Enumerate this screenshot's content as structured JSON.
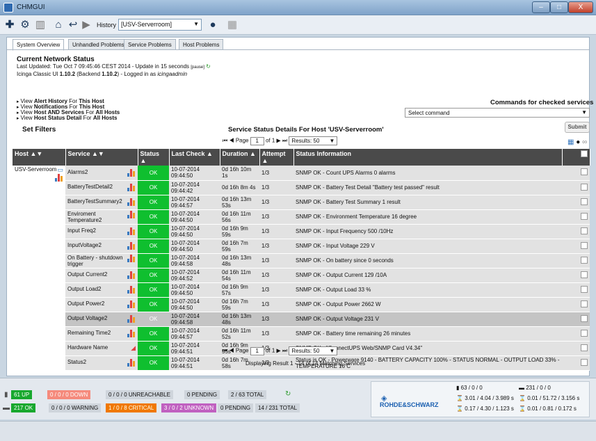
{
  "window": {
    "title": "CHMGUI",
    "min": "–",
    "max": "□",
    "close": "X"
  },
  "toolbar": {
    "history_label": "History",
    "history_value": "[USV-Serverroom]"
  },
  "tabs": [
    "System Overview",
    "Unhandled Problems",
    "Service Problems",
    "Host Problems"
  ],
  "status_info": {
    "heading": "Current Network Status",
    "line1_a": "Last Updated: Tue Oct 7 09:45:46 CEST 2014 - Update in 15 seconds ",
    "line1_pause": "[pause]",
    "line2_a": "Icinga Classic UI ",
    "line2_ver": "1.10.2",
    "line2_b": " (Backend ",
    "line2_be": "1.10.2",
    "line2_c": ") - Logged in as ",
    "line2_user": "icingaadmin"
  },
  "links": [
    [
      "View ",
      "Alert History",
      " For ",
      "This Host"
    ],
    [
      "View ",
      "Notifications",
      " For ",
      "This Host"
    ],
    [
      "View ",
      "Host AND Services",
      " For ",
      "All Hosts"
    ],
    [
      "View ",
      "Host Status Detail",
      " For ",
      "All Hosts"
    ]
  ],
  "set_filters": "Set Filters",
  "commands": {
    "heading": "Commands for checked services",
    "select": "Select command",
    "submit": "Submit"
  },
  "table_title": "Service Status Details For Host 'USV-Serverroom'",
  "pager": {
    "page_label": "Page",
    "page": "1",
    "of": "of 1",
    "results": "Results: 50"
  },
  "columns": [
    "Host ▲▼",
    "Service ▲▼",
    "Status ▲",
    "Last Check ▲",
    "Duration ▲",
    "Attempt ▲",
    "Status Information"
  ],
  "host": "USV-Serverroom",
  "rows": [
    {
      "service": "Alarms2",
      "status": "OK",
      "last": "10-07-2014 09:44:50",
      "dur": "0d 16h 10m 1s",
      "att": "1/3",
      "info": "SNMP OK - Count UPS Alarms 0 alarms",
      "hl": false
    },
    {
      "service": "BatteryTestDetail2",
      "status": "OK",
      "last": "10-07-2014 09:44:42",
      "dur": "0d 16h 8m 4s",
      "att": "1/3",
      "info": "SNMP OK - Battery Test Detail \"Battery test passed\" result",
      "hl": false
    },
    {
      "service": "BatteryTestSummary2",
      "status": "OK",
      "last": "10-07-2014 09:44:57",
      "dur": "0d 16h 13m 53s",
      "att": "1/3",
      "info": "SNMP OK - Battery Test Summary 1 result",
      "hl": false
    },
    {
      "service": "Enviroment Temperature2",
      "status": "OK",
      "last": "10-07-2014 09:44:50",
      "dur": "0d 16h 11m 56s",
      "att": "1/3",
      "info": "SNMP OK - Environment Temperature 16 degree",
      "hl": false
    },
    {
      "service": "Input Freq2",
      "status": "OK",
      "last": "10-07-2014 09:44:50",
      "dur": "0d 16h 9m 59s",
      "att": "1/3",
      "info": "SNMP OK - Input Frequency 500 /10Hz",
      "hl": false
    },
    {
      "service": "InputVoltage2",
      "status": "OK",
      "last": "10-07-2014 09:44:50",
      "dur": "0d 16h 7m 59s",
      "att": "1/3",
      "info": "SNMP OK - Input Voltage 229 V",
      "hl": false
    },
    {
      "service": "On Battery - shutdown trigger",
      "status": "OK",
      "last": "10-07-2014 09:44:58",
      "dur": "0d 16h 13m 48s",
      "att": "1/3",
      "info": "SNMP OK - On battery since 0 seconds",
      "hl": false
    },
    {
      "service": "Output Current2",
      "status": "OK",
      "last": "10-07-2014 09:44:52",
      "dur": "0d 16h 11m 54s",
      "att": "1/3",
      "info": "SNMP OK - Output Current 129 /10A",
      "hl": false
    },
    {
      "service": "Output Load2",
      "status": "OK",
      "last": "10-07-2014 09:44:50",
      "dur": "0d 16h 9m 57s",
      "att": "1/3",
      "info": "SNMP OK - Output Load 33 %",
      "hl": false
    },
    {
      "service": "Output Power2",
      "status": "OK",
      "last": "10-07-2014 09:44:50",
      "dur": "0d 16h 7m 59s",
      "att": "1/3",
      "info": "SNMP OK - Output Power 2662 W",
      "hl": false
    },
    {
      "service": "Output Voltage2",
      "status": "OK",
      "last": "10-07-2014 09:44:58",
      "dur": "0d 16h 13m 48s",
      "att": "1/3",
      "info": "SNMP OK - Output Voltage 231 V",
      "hl": true
    },
    {
      "service": "Remaining Time2",
      "status": "OK",
      "last": "10-07-2014 09:44:57",
      "dur": "0d 16h 11m 52s",
      "att": "1/3",
      "info": "SNMP OK - Battery time remaining 26 minutes",
      "hl": false
    },
    {
      "service": "Hardware Name",
      "status": "OK",
      "last": "10-07-2014 09:44:51",
      "dur": "0d 16h 9m 55s",
      "att": "1/3",
      "info": "SNMP OK - \"ConnectUPS Web/SNMP Card V4.34\"",
      "hl": false
    },
    {
      "service": "Status2",
      "status": "OK",
      "last": "10-07-2014 09:44:51",
      "dur": "0d 16h 7m 58s",
      "att": "1/3",
      "info": "Status is OK - Powerware 9140 - BATTERY CAPACITY 100% - STATUS NORMAL - OUTPUT LOAD 33% - TEMPERATURE 16 C",
      "hl": false
    }
  ],
  "displaying": "Displaying Result 1 - 14 of 14 Matching Services",
  "footer": {
    "hosts_up": "61 UP",
    "hosts_down": "0 / 0 / 0 DOWN",
    "hosts_unreach": "0 / 0 / 0 UNREACHABLE",
    "hosts_pending": "0 PENDING",
    "hosts_total": "2 / 63 TOTAL",
    "svc_ok": "217 OK",
    "svc_warn": "0 / 0 / 0 WARNING",
    "svc_crit": "1 / 0 / 8 CRITICAL",
    "svc_unknown": "3 / 0 / 2 UNKNOWN",
    "svc_pending": "0 PENDING",
    "svc_total": "14 / 231 TOTAL",
    "brand": "ROHDE&SCHWARZ",
    "stats": [
      "63 / 0 / 0",
      "231 / 0 / 0",
      "3.01 / 4.04 / 3.989 s",
      "0.01 / 51.72 / 3.156 s",
      "0.17 / 4.30 / 1.123 s",
      "0.01 / 0.81 / 0.172 s"
    ]
  },
  "colors": {
    "ok": "#0fbf2f",
    "up": "#18a82e",
    "down": "#f58a7c",
    "critical": "#f07800",
    "unknown": "#c060c0"
  }
}
